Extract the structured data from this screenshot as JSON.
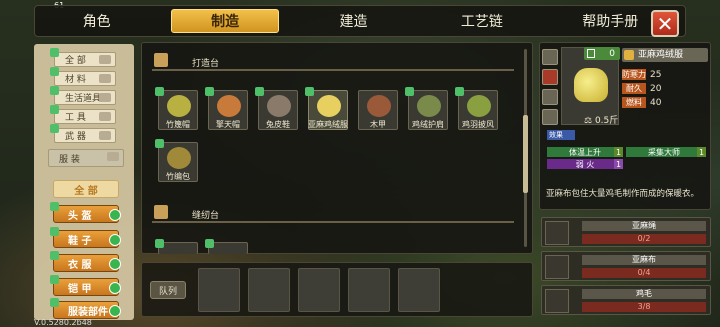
{
  "hud": {
    "fps": "61",
    "version": "V.0.5280.2b48"
  },
  "tabs": [
    {
      "label": "角色",
      "active": false
    },
    {
      "label": "制造",
      "active": true
    },
    {
      "label": "建造",
      "active": false
    },
    {
      "label": "工艺链",
      "active": false
    },
    {
      "label": "帮助手册",
      "active": false
    }
  ],
  "categories": [
    "全 部",
    "材 料",
    "生活道具",
    "工 具",
    "武 器",
    "服 装"
  ],
  "subcategories": [
    "全 部",
    "头 盔",
    "鞋 子",
    "衣 服",
    "铠 甲",
    "服装部件"
  ],
  "stations": [
    {
      "name": "打造台",
      "items": [
        {
          "label": "竹篾帽",
          "color": "#b8b040"
        },
        {
          "label": "擎天帽",
          "color": "#c87a3a"
        },
        {
          "label": "兔皮鞋",
          "color": "#8a7a6a"
        },
        {
          "label": "亚麻鸡绒服",
          "color": "#e8d060"
        },
        {
          "label": "木甲",
          "color": "#9a5a3a"
        },
        {
          "label": "鸡绒护肩",
          "color": "#7a8a4a"
        },
        {
          "label": "鸡羽披风",
          "color": "#8aa040"
        },
        {
          "label": "竹编包",
          "color": "#a08a3a"
        }
      ]
    },
    {
      "name": "缝纫台",
      "items": []
    }
  ],
  "queue": {
    "label": "队列"
  },
  "detail": {
    "count": "0",
    "name": "亚麻鸡绒服",
    "weight": "0.5斤",
    "stats": [
      {
        "key": "防寒力",
        "value": "25"
      },
      {
        "key": "耐久",
        "value": "20"
      },
      {
        "key": "燃料",
        "value": "40"
      }
    ],
    "tag": "效果",
    "bonuses": [
      {
        "label": "体温上升",
        "value": "1"
      },
      {
        "label": "采集大师",
        "value": "1"
      },
      {
        "label": "弱 火",
        "value": "1"
      }
    ],
    "description": "亚麻布包住大量鸡毛制作而成的保暖衣。"
  },
  "materials": [
    {
      "name": "亚麻绳",
      "amount": "0/2"
    },
    {
      "name": "亚麻布",
      "amount": "0/4"
    },
    {
      "name": "鸡毛",
      "amount": "3/8"
    }
  ]
}
